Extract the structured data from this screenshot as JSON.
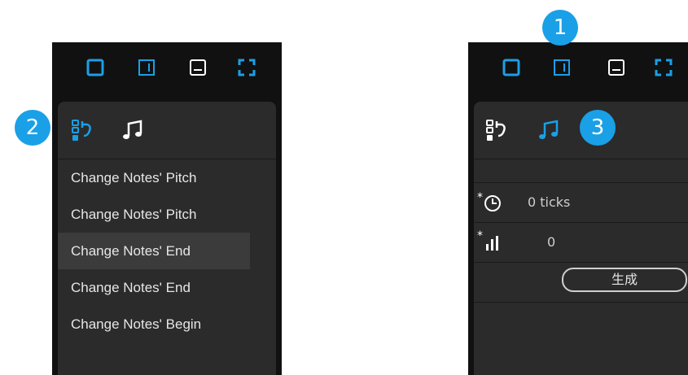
{
  "left": {
    "history": [
      "Change Notes' Pitch",
      "Change Notes' Pitch",
      "Change Notes' End",
      "Change Notes' End",
      "Change Notes' Begin"
    ],
    "selected_index": 2
  },
  "right": {
    "offset_value": "0 ticks",
    "velocity_value": "0",
    "generate_label": "生成"
  },
  "badges": {
    "one": "1",
    "two": "2",
    "three": "3"
  },
  "colors": {
    "accent": "#1aa0e6",
    "panel": "#2b2b2b",
    "frame": "#111111",
    "text": "#e6e6e6"
  },
  "icons": {
    "view_modes": [
      "single-window-icon",
      "split-vertical-icon",
      "split-horizontal-icon",
      "fullscreen-icon"
    ],
    "tabs": [
      "history-icon",
      "music-note-icon"
    ],
    "params": [
      "time-offset-icon",
      "velocity-icon"
    ]
  }
}
